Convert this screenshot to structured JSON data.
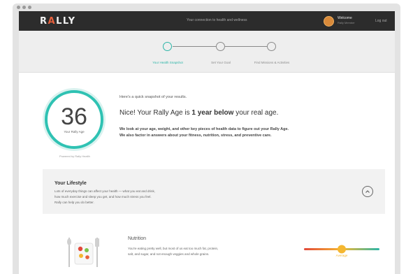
{
  "nav": {
    "logo_prefix": "R",
    "logo_accent": "A",
    "logo_suffix": "LLY",
    "center_text": "Your connection to health and wellness",
    "user_name": "Welcome",
    "user_sub": "Rally Member",
    "right_text": "Log out"
  },
  "stepper": {
    "steps": [
      {
        "label": "Your Health Snapshot"
      },
      {
        "label": "Set Your Goal"
      },
      {
        "label": "Find Missions & Activities"
      }
    ],
    "active_color": "#2bb5a7"
  },
  "score": {
    "value": "36",
    "label": "Your Rally Age",
    "powered": "Powered by Rally Health"
  },
  "summary": {
    "intro": "Here's a quick snapshot of your results.",
    "headline_pre": "Nice! Your Rally Age is ",
    "headline_bold": "1 year below",
    "headline_post": " your real age.",
    "explain_1": "We look at your age, weight, and other key pieces of health data to figure out your Rally Age.",
    "explain_2": "We also factor in answers about your fitness, nutrition, stress, and preventive care."
  },
  "lifestyle": {
    "title": "Your Lifestyle",
    "line_1": "Lots of everyday things can affect your health — what you eat and drink,",
    "line_2": "how much exercise and sleep you get, and how much stress you feel.",
    "line_3": "Rally can help you do better.",
    "toggle_icon": "chevron-up-icon"
  },
  "nutrition": {
    "title": "Nutrition",
    "line_1": "You're eating pretty well, but most of us eat too much fat, protein,",
    "line_2": "salt, and sugar, and not enough veggies and whole grains.",
    "slider_value": 0.5,
    "slider_label": "Average",
    "colors": {
      "low": "#e2483a",
      "mid": "#f5b731",
      "high": "#2bb5a7"
    }
  }
}
